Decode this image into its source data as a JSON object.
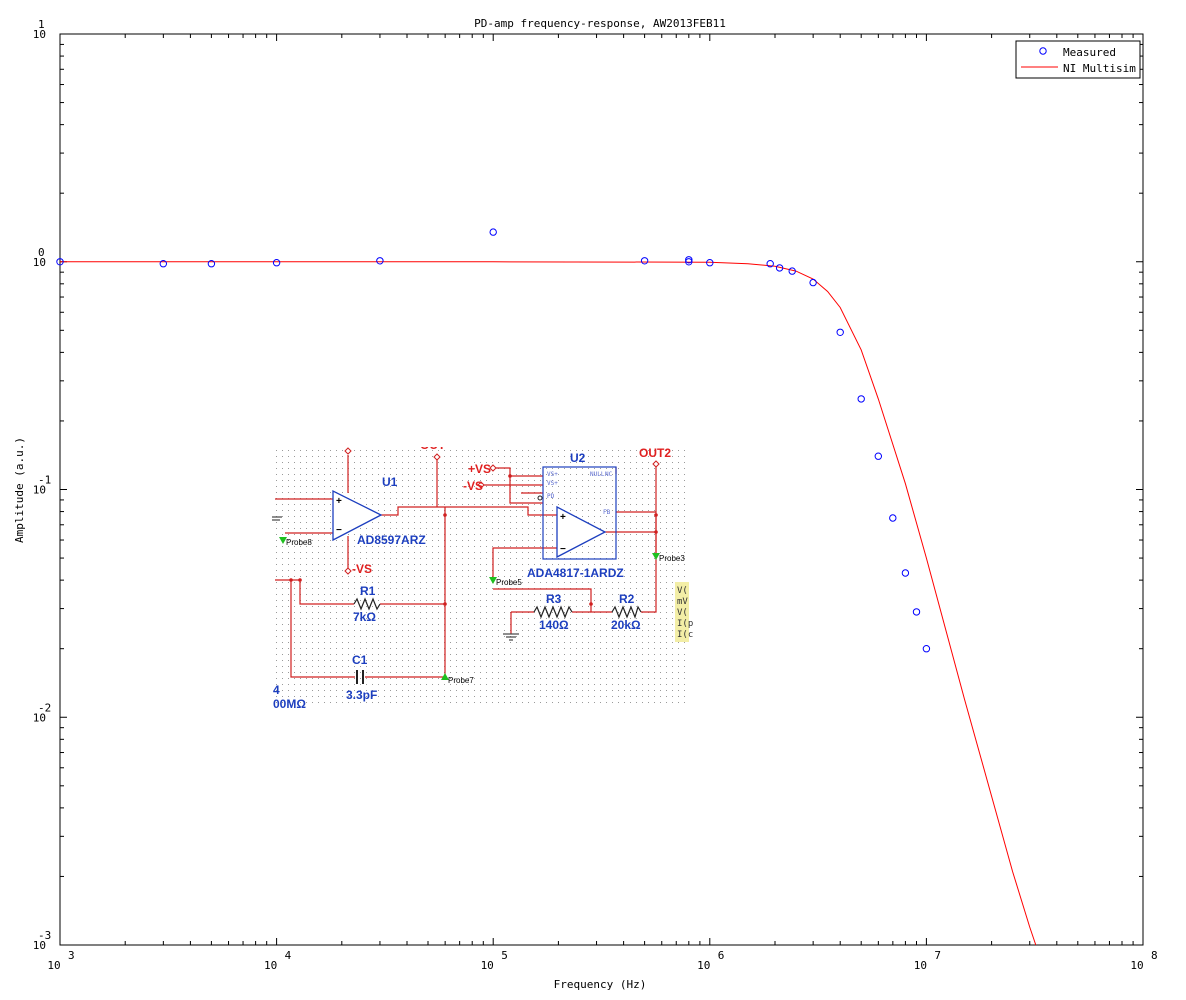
{
  "chart_data": {
    "type": "scatter",
    "title": "PD-amp frequency-response, AW2013FEB11",
    "xlabel": "Frequency (Hz)",
    "ylabel": "Amplitude (a.u.)",
    "xscale": "log",
    "yscale": "log",
    "xlim": [
      1000,
      100000000
    ],
    "ylim": [
      0.001,
      10
    ],
    "x_ticks": [
      {
        "base": "10",
        "exp": "3"
      },
      {
        "base": "10",
        "exp": "4"
      },
      {
        "base": "10",
        "exp": "5"
      },
      {
        "base": "10",
        "exp": "6"
      },
      {
        "base": "10",
        "exp": "7"
      },
      {
        "base": "10",
        "exp": "8"
      }
    ],
    "y_ticks": [
      {
        "value": 0.001,
        "base": "10",
        "exp": "-3"
      },
      {
        "value": 0.01,
        "base": "10",
        "exp": "-2"
      },
      {
        "value": 0.1,
        "base": "10",
        "exp": "-1"
      },
      {
        "value": 1,
        "base": "10",
        "exp": "0"
      },
      {
        "value": 10,
        "base": "10",
        "exp": "1"
      }
    ],
    "grid": false,
    "legend_position": "top-right",
    "series": [
      {
        "name": "Measured",
        "style": "markers",
        "color": "#0000ff",
        "x": [
          1000,
          3000,
          5000,
          10000,
          30000,
          100000,
          500000,
          800000,
          800000,
          1000000,
          1900000,
          2100000,
          2400000,
          3000000,
          4000000,
          5000000,
          6000000,
          7000000,
          8000000,
          9000000,
          10000000
        ],
        "y": [
          1.0,
          0.98,
          0.98,
          0.99,
          1.01,
          1.35,
          1.01,
          1.0,
          1.02,
          0.99,
          0.98,
          0.94,
          0.91,
          0.81,
          0.49,
          0.25,
          0.14,
          0.075,
          0.043,
          0.029,
          0.02
        ]
      },
      {
        "name": "NI Multisim",
        "style": "line",
        "color": "#ff0000",
        "x": [
          1000,
          10000,
          100000,
          1000000,
          1500000,
          2000000,
          2500000,
          3000000,
          3500000,
          4000000,
          5000000,
          6000000,
          8000000,
          10000000,
          15000000,
          20000000,
          25000000,
          30000000,
          32000000
        ],
        "y": [
          1.0,
          1.0,
          1.0,
          0.995,
          0.98,
          0.955,
          0.91,
          0.84,
          0.74,
          0.63,
          0.41,
          0.25,
          0.106,
          0.05,
          0.012,
          0.0045,
          0.0021,
          0.0012,
          0.001
        ]
      }
    ]
  },
  "schematic": {
    "u1_label": "U1",
    "u1_part": "AD8597ARZ",
    "u2_label": "U2",
    "u2_part": "ADA4817-1ARDZ",
    "r1_label": "R1",
    "r1_value": "7kΩ",
    "r2_label": "R2",
    "r2_value": "20kΩ",
    "r3_label": "R3",
    "r3_value": "140Ω",
    "c1_label": "C1",
    "c1_value": "3.3pF",
    "vs_pos": "+VS",
    "vs_neg_u2": "-VS",
    "vs_neg_u1": "-VS",
    "out1_partial": "OUT",
    "out2": "OUT2",
    "probe3": "Probe3",
    "probe5": "Probe5",
    "probe7": "Probe7",
    "probe8": "Probe8",
    "cut_label_1": "4",
    "cut_label_2": "00MΩ",
    "meas_box_lines": [
      "V(",
      "mV",
      "V(",
      "I(p",
      "I(c"
    ],
    "u2_pin_labels": [
      "VS+",
      "VS+",
      "PD",
      "FB",
      "NULL",
      "NC"
    ]
  }
}
